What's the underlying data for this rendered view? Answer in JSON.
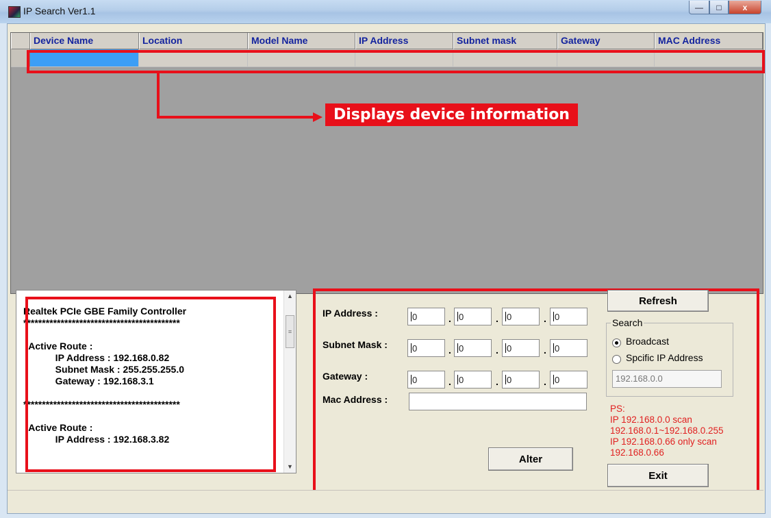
{
  "window": {
    "title": "IP Search Ver1.1",
    "caption_buttons": {
      "minimize": "—",
      "maximize": "□",
      "close": "x"
    }
  },
  "grid": {
    "columns": [
      "Device Name",
      "Location",
      "Model Name",
      "IP Address",
      "Subnet mask",
      "Gateway",
      "MAC Address"
    ],
    "callout": "Displays device information"
  },
  "adapter_info": {
    "text": "Realtek PCIe GBE Family Controller\n******************************************\n\n  Active Route :\n            IP Address : 192.168.0.82\n            Subnet Mask : 255.255.255.0\n            Gateway : 192.168.3.1\n\n******************************************\n\n  Active Route :\n            IP Address : 192.168.3.82"
  },
  "settings": {
    "ip_label": "IP Address :",
    "subnet_label": "Subnet Mask :",
    "gateway_label": "Gateway :",
    "mac_label": "Mac Address :",
    "ip": [
      "0",
      "0",
      "0",
      "0"
    ],
    "subnet": [
      "0",
      "0",
      "0",
      "0"
    ],
    "gateway": [
      "0",
      "0",
      "0",
      "0"
    ],
    "mac": "",
    "octet_separator": "."
  },
  "buttons": {
    "refresh": "Refresh",
    "alter": "Alter",
    "exit": "Exit"
  },
  "search": {
    "title": "Search",
    "broadcast": "Broadcast",
    "specific": "Spcific IP Address",
    "address": "192.168.0.0",
    "selected": "Broadcast"
  },
  "ps_note": "PS:\nIP 192.168.0.0 scan\n192.168.0.1~192.168.0.255\nIP 192.168.0.66 only scan\n192.168.0.66",
  "colors": {
    "highlight": "#e8101a",
    "selection": "#3c9ef5",
    "header_text": "#13239e",
    "ps_text": "#e01f1f"
  }
}
